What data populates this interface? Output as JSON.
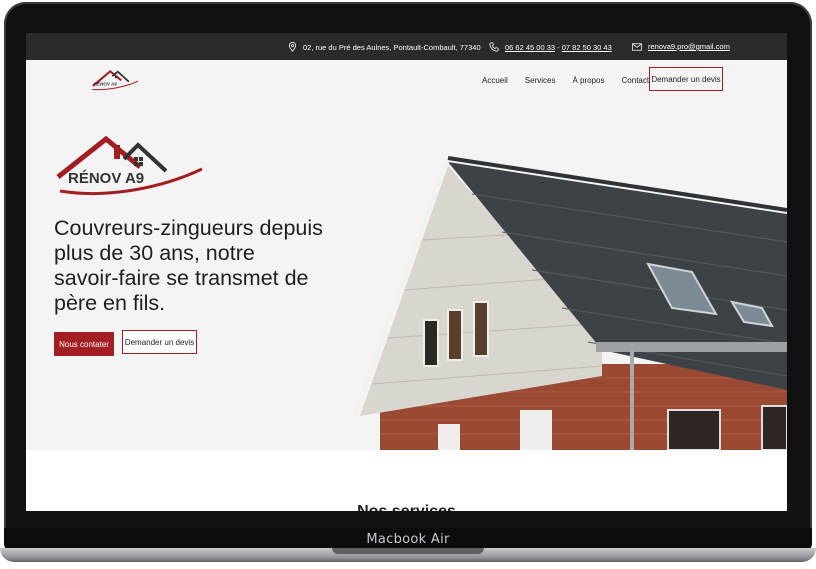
{
  "device": {
    "label": "Macbook Air"
  },
  "topbar": {
    "address": "02, rue du Pré des Aulnes, Pontault-Combault, 77340",
    "phone_1": "06 62 45 00 33",
    "phone_sep": " - ",
    "phone_2": "07 82 50 30 43",
    "email": "renova9.pro@gmail.com"
  },
  "brand": {
    "name": "RÉNOV A9",
    "color": "#a31e22"
  },
  "nav": {
    "items": [
      "Accueil",
      "Services",
      "À propos",
      "Contact"
    ],
    "cta": "Demander un devis"
  },
  "hero": {
    "headline": "Couvreurs-zingueurs depuis plus de 30 ans, notre savoir-faire se transmet de père en fils.",
    "primary_button": "Nous contater",
    "secondary_button": "Demander un devis"
  },
  "services": {
    "title": "Nos services"
  },
  "icons": {
    "address": "location-pin-icon",
    "phone": "phone-icon",
    "email": "envelope-icon"
  }
}
